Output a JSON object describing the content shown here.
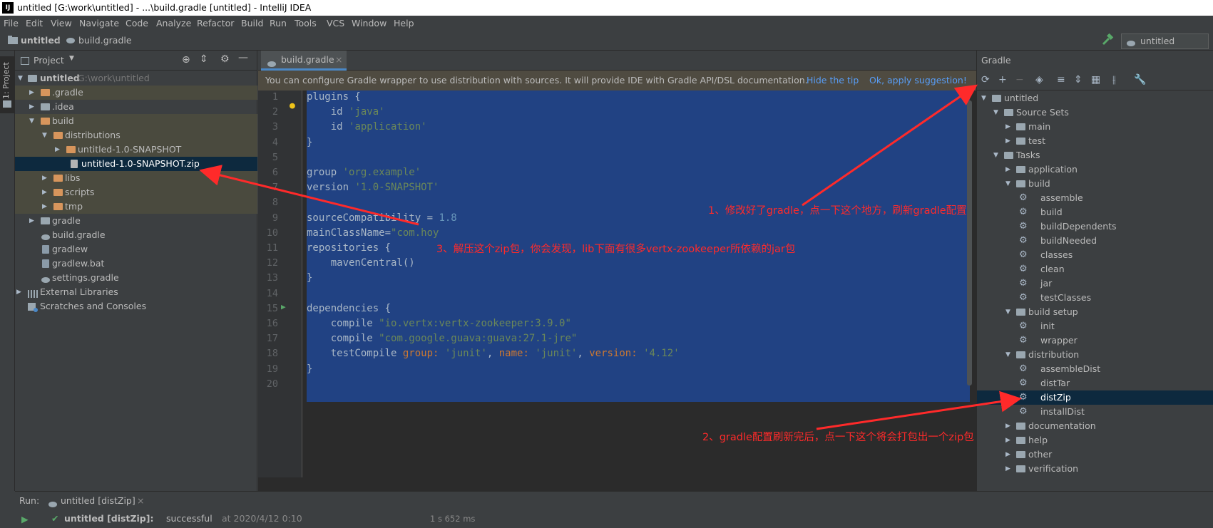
{
  "window": {
    "app_icon": "IJ",
    "title": "untitled [G:\\work\\untitled] - ...\\build.gradle [untitled] - IntelliJ IDEA"
  },
  "menu": [
    "File",
    "Edit",
    "View",
    "Navigate",
    "Code",
    "Analyze",
    "Refactor",
    "Build",
    "Run",
    "Tools",
    "VCS",
    "Window",
    "Help"
  ],
  "navbar": {
    "crumb_project": "untitled",
    "crumb_file": "build.gradle",
    "run_config": "untitled [distZip]"
  },
  "left_stripe": {
    "project_tab": "1: Project"
  },
  "project_panel": {
    "title": "Project",
    "tree": [
      {
        "label": "untitled",
        "extra": "G:\\work\\untitled"
      },
      {
        "label": ".gradle"
      },
      {
        "label": ".idea"
      },
      {
        "label": "build"
      },
      {
        "label": "distributions"
      },
      {
        "label": "untitled-1.0-SNAPSHOT"
      },
      {
        "label": "untitled-1.0-SNAPSHOT.zip"
      },
      {
        "label": "libs"
      },
      {
        "label": "scripts"
      },
      {
        "label": "tmp"
      },
      {
        "label": "gradle"
      },
      {
        "label": "build.gradle"
      },
      {
        "label": "gradlew"
      },
      {
        "label": "gradlew.bat"
      },
      {
        "label": "settings.gradle"
      },
      {
        "label": "External Libraries"
      },
      {
        "label": "Scratches and Consoles"
      }
    ]
  },
  "editor": {
    "tab": "build.gradle",
    "banner": {
      "message": "You can configure Gradle wrapper to use distribution with sources. It will provide IDE with Gradle API/DSL documentation.",
      "hide": "Hide the tip",
      "apply": "Ok, apply suggestion!"
    },
    "line_numbers": [
      "1",
      "2",
      "3",
      "4",
      "5",
      "6",
      "7",
      "8",
      "9",
      "10",
      "11",
      "12",
      "13",
      "14",
      "15",
      "16",
      "17",
      "18",
      "19",
      "20"
    ],
    "lines": [
      [
        "plugins {"
      ],
      [
        "    id ",
        "'java'"
      ],
      [
        "    id ",
        "'application'"
      ],
      [
        "}"
      ],
      [
        ""
      ],
      [
        "group ",
        "'org.example'"
      ],
      [
        "version ",
        "'1.0-SNAPSHOT'"
      ],
      [
        ""
      ],
      [
        "sourceCompatibility = ",
        "1.8"
      ],
      [
        "mainClassName=",
        "\"com.hoy"
      ],
      [
        "repositories {"
      ],
      [
        "    mavenCentral()"
      ],
      [
        "}"
      ],
      [
        ""
      ],
      [
        "dependencies {"
      ],
      [
        "    compile ",
        "\"io.vertx:vertx-zookeeper:3.9.0\""
      ],
      [
        "    compile ",
        "\"com.google.guava:guava:27.1-jre\""
      ],
      [
        "    testCompile ",
        "group: ",
        "'junit'",
        ", ",
        "name: ",
        "'junit'",
        ", ",
        "version: ",
        "'4.12'"
      ],
      [
        "}"
      ],
      [
        ""
      ]
    ]
  },
  "gradle_panel": {
    "title": "Gradle",
    "tree": [
      {
        "label": "untitled"
      },
      {
        "label": "Source Sets"
      },
      {
        "label": "main"
      },
      {
        "label": "test"
      },
      {
        "label": "Tasks"
      },
      {
        "label": "application"
      },
      {
        "label": "build"
      },
      {
        "label": "assemble"
      },
      {
        "label": "build"
      },
      {
        "label": "buildDependents"
      },
      {
        "label": "buildNeeded"
      },
      {
        "label": "classes"
      },
      {
        "label": "clean"
      },
      {
        "label": "jar"
      },
      {
        "label": "testClasses"
      },
      {
        "label": "build setup"
      },
      {
        "label": "init"
      },
      {
        "label": "wrapper"
      },
      {
        "label": "distribution"
      },
      {
        "label": "assembleDist"
      },
      {
        "label": "distTar"
      },
      {
        "label": "distZip"
      },
      {
        "label": "installDist"
      },
      {
        "label": "documentation"
      },
      {
        "label": "help"
      },
      {
        "label": "other"
      },
      {
        "label": "verification"
      }
    ]
  },
  "run_panel": {
    "label": "Run:",
    "tab": "untitled [distZip]",
    "result_name": "untitled [distZip]:",
    "result_status": "successful",
    "result_time": "at 2020/4/12 0:10",
    "duration": "1 s 652 ms"
  },
  "annotations": {
    "note1": "1、修改好了gradle，点一下这个地方，刷新gradle配置",
    "note2": "2、gradle配置刷新完后，点一下这个将会打包出一个zip包",
    "note3": "3、解压这个zip包，你会发现，lib下面有很多vertx-zookeeper所依赖的jar包"
  },
  "colors": {
    "accent_annotation": "#ff2a2a",
    "selection": "#214283",
    "link": "#589df6"
  }
}
